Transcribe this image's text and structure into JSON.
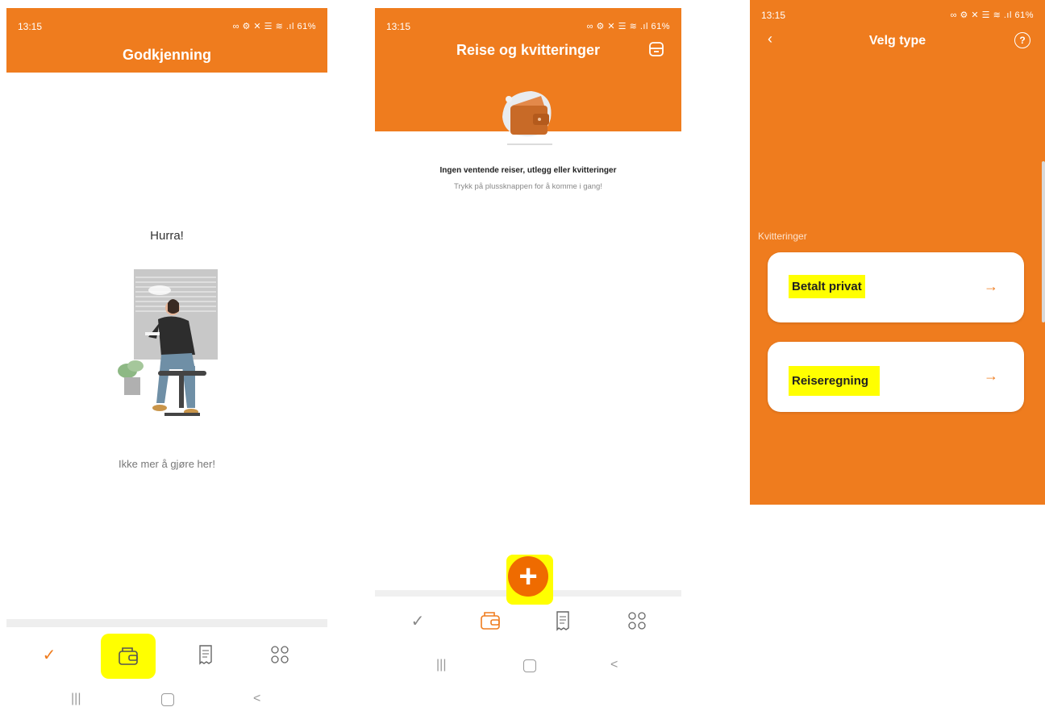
{
  "screen1": {
    "status": {
      "time": "13:15",
      "icons": "∞ ⚙ ✕ ☰ ≋ .ıl 61%"
    },
    "title": "Godkjenning",
    "heading": "Hurra!",
    "message": "Ikke mer å gjøre her!",
    "nav": [
      "approvals-check-icon",
      "wallet-icon",
      "receipt-icon",
      "apps-grid-icon"
    ]
  },
  "screen2": {
    "status": {
      "time": "13:15",
      "icons": "∞ ⚙ ✕ ☰ ≋ .ıl 61%"
    },
    "title": "Reise og kvitteringer",
    "empty_title": "Ingen ventende reiser, utlegg eller kvitteringer",
    "empty_sub": "Trykk på plussknappen for å komme i gang!",
    "nav": [
      "approvals-check-icon",
      "wallet-icon",
      "receipt-icon",
      "apps-grid-icon"
    ]
  },
  "screen3": {
    "status": {
      "time": "13:15",
      "icons": "∞ ⚙ ✕ ☰ ≋ .ıl 61%"
    },
    "title": "Velg type",
    "section_label": "Kvitteringer",
    "options": [
      {
        "label": "Betalt privat",
        "arrow": "→"
      },
      {
        "label": "Reiseregning",
        "arrow": "→"
      }
    ]
  },
  "system": {
    "recent": "|||",
    "back": "<"
  },
  "colors": {
    "accent": "#ef7c1e",
    "highlight": "#ffff00"
  }
}
